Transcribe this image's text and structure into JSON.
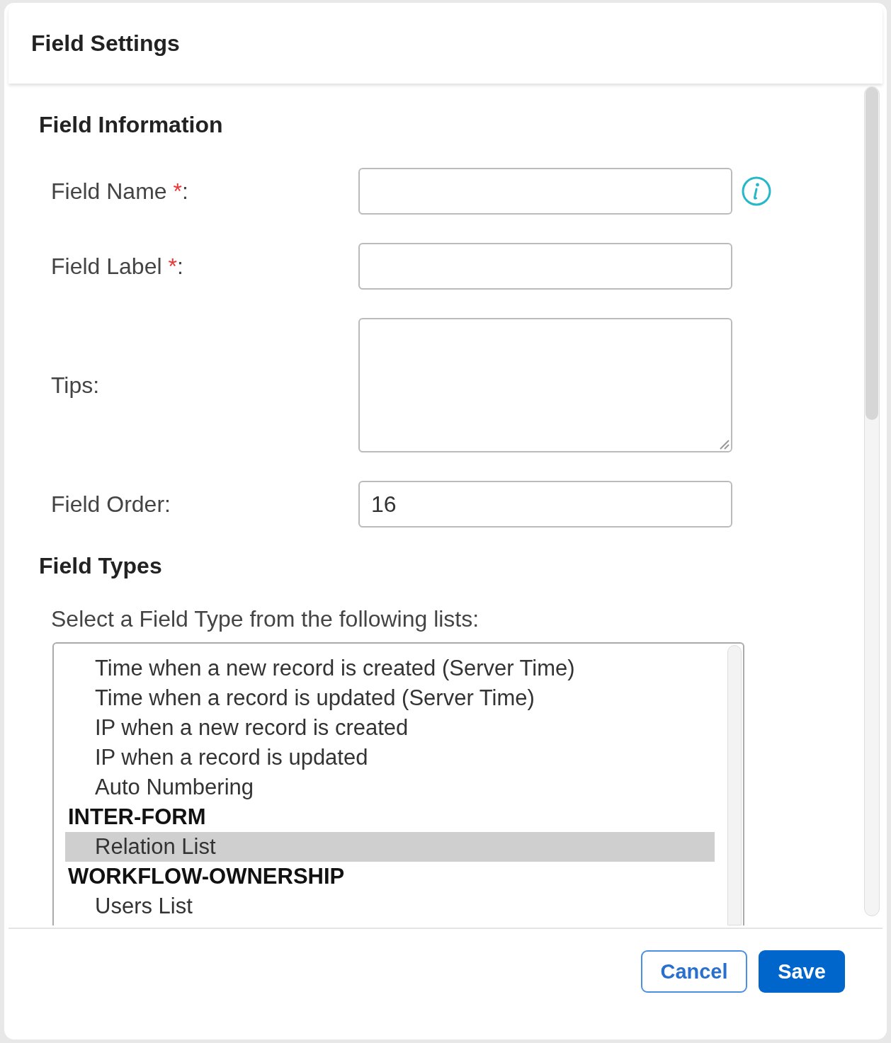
{
  "dialog": {
    "title": "Field Settings"
  },
  "field_information": {
    "heading": "Field Information",
    "fields": [
      {
        "kind": "input",
        "label": "Field Name",
        "required_mark": "*",
        "colon": ":",
        "info": true
      },
      {
        "kind": "input",
        "label": "Field Label",
        "required_mark": "*",
        "colon": ":",
        "info": false
      },
      {
        "kind": "textarea",
        "label": "Tips",
        "colon": ":",
        "info": false
      },
      {
        "kind": "input",
        "label": "Field Order",
        "colon": ":",
        "info": false,
        "value": "16"
      }
    ]
  },
  "field_types": {
    "heading": "Field Types",
    "prompt": "Select a Field Type from the following lists:",
    "list": [
      {
        "kind": "option",
        "label": "Time when a new record is created (Server Time)",
        "selected": false
      },
      {
        "kind": "option",
        "label": "Time when a record is updated (Server Time)",
        "selected": false
      },
      {
        "kind": "option",
        "label": "IP when a new record is created",
        "selected": false
      },
      {
        "kind": "option",
        "label": "IP when a record is updated",
        "selected": false
      },
      {
        "kind": "option",
        "label": "Auto Numbering",
        "selected": false
      },
      {
        "kind": "group",
        "label": "INTER-FORM"
      },
      {
        "kind": "option",
        "label": "Relation List",
        "selected": true
      },
      {
        "kind": "group",
        "label": "WORKFLOW-OWNERSHIP"
      },
      {
        "kind": "option",
        "label": "Users List",
        "selected": false
      }
    ]
  },
  "buttons": [
    {
      "kind": "secondary",
      "label": "Cancel"
    },
    {
      "kind": "primary",
      "label": "Save"
    }
  ]
}
